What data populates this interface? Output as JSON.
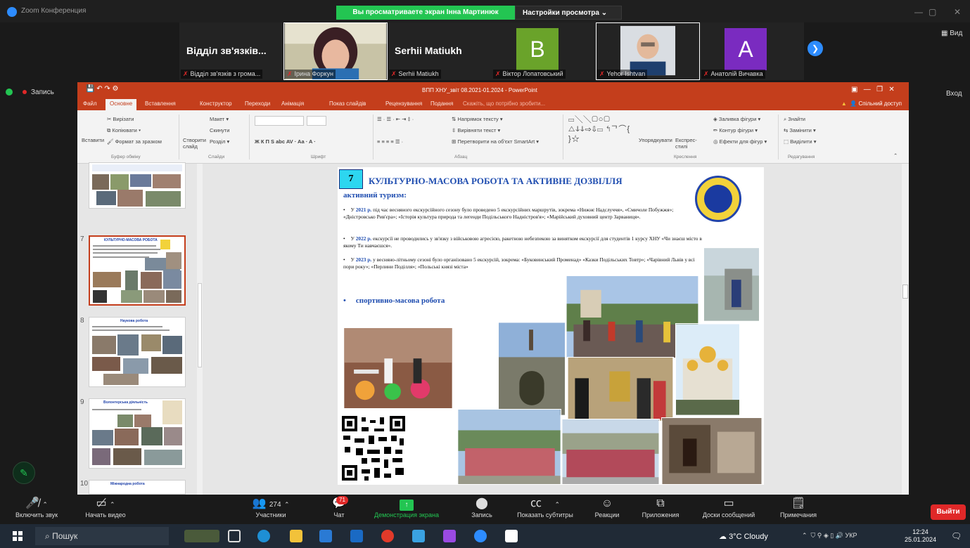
{
  "window": {
    "app_title": "Zoom Конференция",
    "share_banner": "Вы просматриваете экран Інна Мартинюк",
    "view_settings": "Настройки просмотра",
    "view_btn": "Вид",
    "vhod_btn": "Вход",
    "record_label": "Запись"
  },
  "participants": [
    {
      "big_name": "Відділ зв'язків...",
      "caption": "Відділ зв'язків з грома..."
    },
    {
      "big_name": "",
      "caption": "Ірина Форкун"
    },
    {
      "big_name": "Serhii Matiukh",
      "caption": "Serhii Matiukh"
    },
    {
      "big_name": "",
      "caption": "Віктор Лопатовський",
      "letter": "B",
      "color": "#6aa32a"
    },
    {
      "big_name": "",
      "caption": "Yehor Ishtvan"
    },
    {
      "big_name": "",
      "caption": "Анатолій Вичавка",
      "letter": "A",
      "color": "#7a2bc0"
    }
  ],
  "ppt": {
    "doc_title": "ВПП ХНУ_звіт 08.2021-01.2024 - PowerPoint",
    "tabs": [
      "Файл",
      "Основне",
      "Вставлення",
      "Конструктор",
      "Переходи",
      "Анімація",
      "Показ слайдів",
      "Рецензування",
      "Подання",
      "Скажіть, що потрібно зробити..."
    ],
    "share": "Спільний доступ",
    "ribbon": {
      "cut": "Вирізати",
      "copy": "Копіювати",
      "format_painter": "Формат за зразком",
      "paste": "Вставити",
      "clipboard_group": "Буфер обміну",
      "new_slide": "Створити слайд",
      "layout": "Макет",
      "reset": "Скинути",
      "section": "Розділ",
      "slides_group": "Слайди",
      "font_group": "Шрифт",
      "text_direction": "Напрямок тексту",
      "align_text": "Вирівняти текст",
      "smartart": "Перетворити на об'єкт SmartArt",
      "paragraph_group": "Абзац",
      "arrange": "Упорядкувати",
      "quick_styles": "Експрес-стилі",
      "shape_fill": "Заливка фігури",
      "shape_outline": "Контур фігури",
      "shape_effects": "Ефекти для фігур",
      "drawing_group": "Креслення",
      "find": "Знайти",
      "replace": "Замінити",
      "select": "Виділити",
      "editing_group": "Редагування"
    },
    "thumb_numbers": [
      "7",
      "8",
      "9",
      "10"
    ],
    "thumb_titles": [
      "КУЛЬТУРНО-МАСОВА РОБОТА",
      "Наукова робота",
      "Волонтерська діяльність",
      "Міжнародна робота"
    ]
  },
  "slide": {
    "number": "7",
    "title": "КУЛЬТУРНО-МАСОВА РОБОТА ТА АКТИВНЕ ДОЗВІЛЛЯ",
    "sub1": "активний туризм:",
    "p1_year": "2021 р.",
    "p1_pre": "У",
    "p1_text": "під час весняного екскурсійного сезону було проведено 5 екскурсійних маршрутів, зокрема «Нижнє Надслуччя», «Смичоле Побужжя»; «Дністровсько Рив'єра»; «Історія культура природа та легенди Подільського Надністров'я»; «Марійський духовний центр Зарваниця».",
    "p2_pre": "У",
    "p2_year": "2022 р.",
    "p2_text": "екскурсії не проводились у зв'язку з військовою агресією, ракетною небезпекою за винятком екскурсії для студентів 1 курсу ХНУ «Чи знаєш місто в якому Ти навчаєшся».",
    "p3_pre": "У",
    "p3_year": "2023 р.",
    "p3_text": "у весняно-літньому сезоні було організовано 5 екскурсій, зокрема: «Буковинський Променад» «Казки Подільських Товтр»; «Чарівний Львів у всі пори року»; «Перлини Поділля»; «Польські князі міста»",
    "sub2": "спортивно-масова робота",
    "bullet": "•"
  },
  "toolbar": {
    "mute": "Включить звук",
    "video": "Начать видео",
    "participants": "Участники",
    "participants_count": "274",
    "chat": "Чат",
    "chat_badge": "71",
    "share": "Демонстрация экрана",
    "record": "Запись",
    "captions": "Показать субтитры",
    "reactions": "Реакции",
    "apps": "Приложения",
    "whiteboards": "Доски сообщений",
    "notes": "Примечания",
    "leave": "Выйти"
  },
  "taskbar": {
    "search": "Пошук",
    "weather": "3°C Cloudy",
    "lang": "УКР",
    "time": "12:24",
    "date": "25.01.2024"
  }
}
